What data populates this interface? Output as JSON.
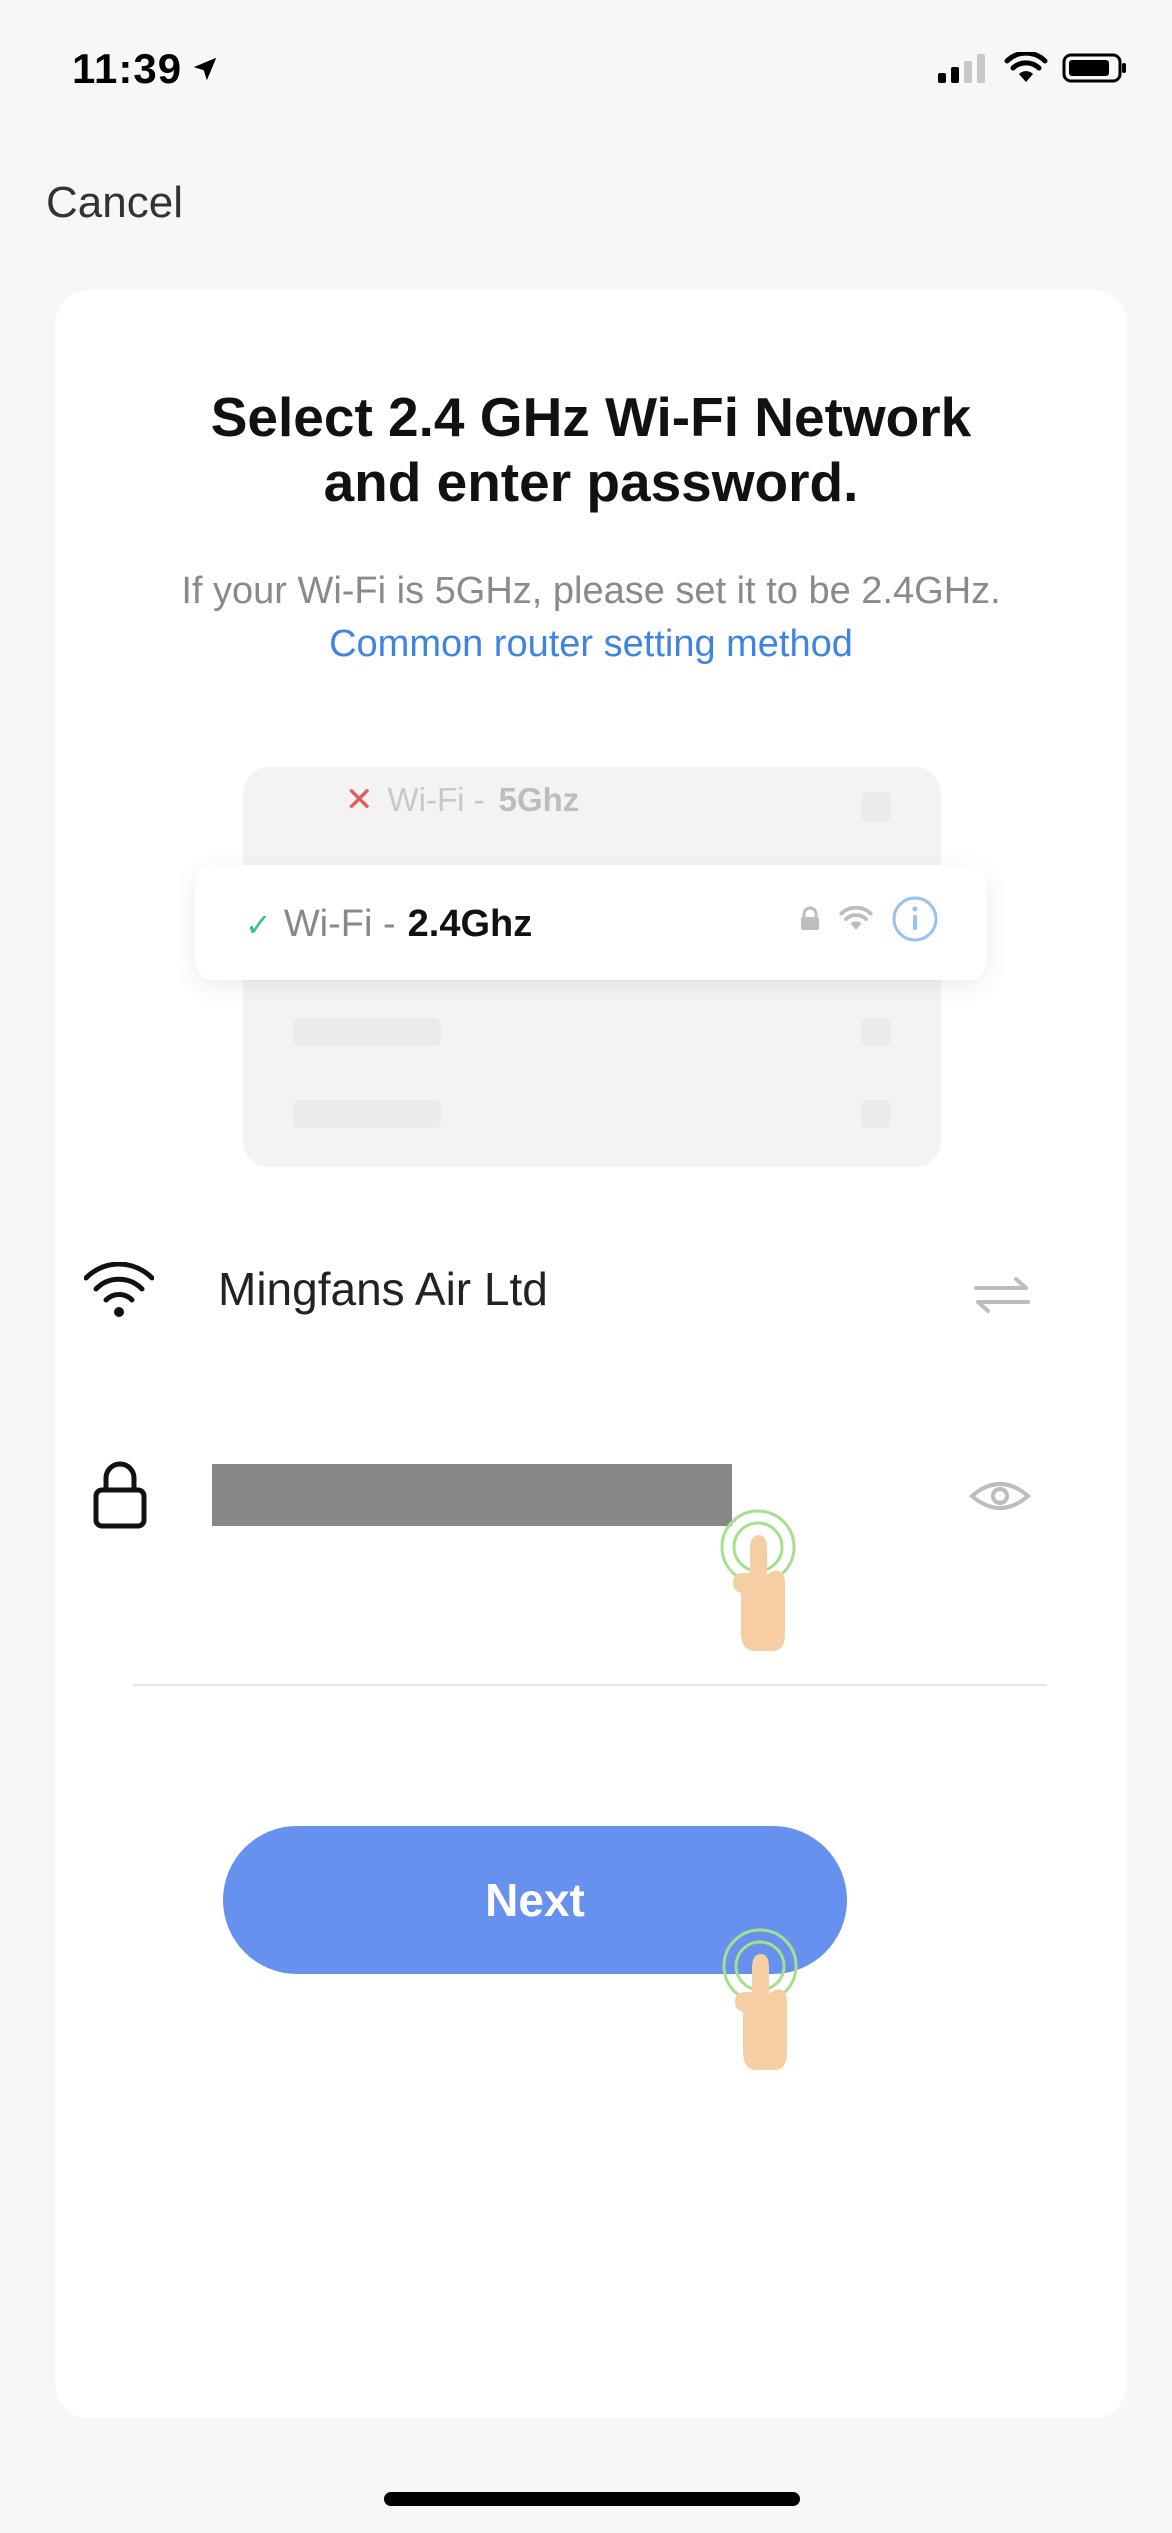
{
  "status_bar": {
    "time": "11:39",
    "icons": [
      "location-arrow-icon",
      "signal-icon",
      "wifi-icon",
      "battery-icon"
    ]
  },
  "nav": {
    "cancel_label": "Cancel"
  },
  "header": {
    "title_line1": "Select 2.4 GHz Wi-Fi Network",
    "title_line2": "and enter password.",
    "subtitle_text": "If your Wi-Fi is 5GHz, please set it to be 2.4GHz.",
    "subtitle_link": "Common router setting method"
  },
  "illustration": {
    "row_5g_prefix": "Wi-Fi -",
    "row_5g_band": "5Ghz",
    "row_24g_prefix": "Wi-Fi -",
    "row_24g_band": "2.4Ghz"
  },
  "form": {
    "wifi_name": "Mingfans Air Ltd",
    "password_value": ""
  },
  "actions": {
    "next_label": "Next"
  },
  "colors": {
    "accent": "#6691ee",
    "link": "#3f84e3",
    "check": "#3fbf8e",
    "cross": "#e35a5a"
  }
}
